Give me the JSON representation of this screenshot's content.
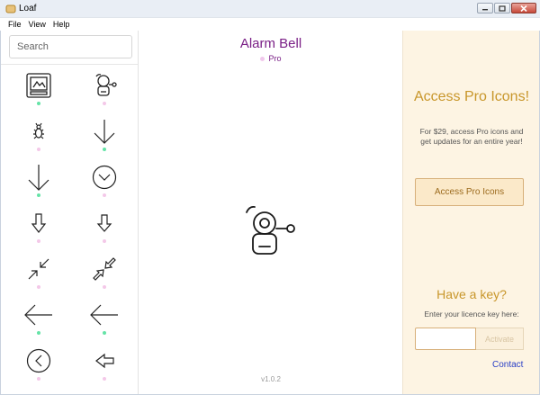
{
  "window": {
    "title": "Loaf"
  },
  "menu": {
    "items": [
      "File",
      "View",
      "Help"
    ]
  },
  "sidebar": {
    "search_placeholder": "Search",
    "icons": [
      {
        "name": "monitor-icon",
        "tier": "free"
      },
      {
        "name": "alarm-bell-icon",
        "tier": "pro"
      },
      {
        "name": "bug-icon",
        "tier": "pro"
      },
      {
        "name": "arrow-down-thin-icon",
        "tier": "free"
      },
      {
        "name": "arrow-down-long-icon",
        "tier": "free"
      },
      {
        "name": "arrow-down-circle-icon",
        "tier": "pro"
      },
      {
        "name": "arrow-down-outline-icon",
        "tier": "pro"
      },
      {
        "name": "arrow-down-bold-outline-icon",
        "tier": "pro"
      },
      {
        "name": "arrows-collapse-diagonal-icon",
        "tier": "pro"
      },
      {
        "name": "arrows-collapse-diagonal-outline-icon",
        "tier": "pro"
      },
      {
        "name": "arrow-left-long-icon",
        "tier": "free"
      },
      {
        "name": "arrow-left-long-alt-icon",
        "tier": "free"
      },
      {
        "name": "arrow-left-circle-icon",
        "tier": "pro"
      },
      {
        "name": "arrow-left-outline-icon",
        "tier": "pro"
      }
    ]
  },
  "preview": {
    "title": "Alarm Bell",
    "tier": "Pro",
    "version": "v1.0.2"
  },
  "pro_panel": {
    "heading": "Access Pro Icons!",
    "description": "For $29, access Pro icons and get updates for an entire year!",
    "button_label": "Access Pro Icons",
    "key_heading": "Have a key?",
    "key_description": "Enter your licence key here:",
    "activate_label": "Activate",
    "contact_label": "Contact"
  },
  "colors": {
    "accent_purple": "#7a1f86",
    "pro_gold": "#c8962a",
    "pro_panel_bg": "#fdf4e3",
    "free_dot": "#65e3a7",
    "pro_dot": "#f4c8e8",
    "link_blue": "#2a3fc6"
  }
}
